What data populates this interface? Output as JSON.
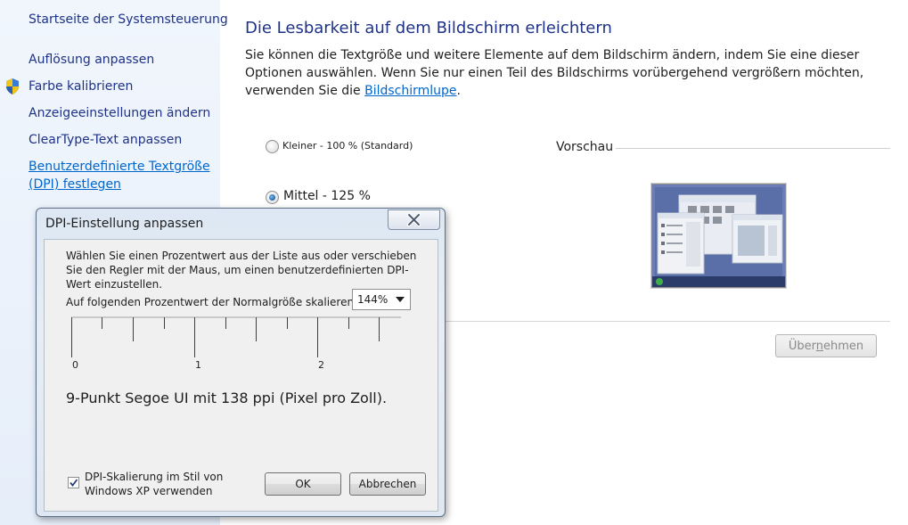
{
  "sidebar": {
    "items": [
      {
        "label": "Startseite der Systemsteuerung"
      },
      {
        "label": "Auflösung anpassen"
      },
      {
        "label": "Farbe kalibrieren"
      },
      {
        "label": "Anzeigeeinstellungen ändern"
      },
      {
        "label": "ClearType-Text anpassen"
      },
      {
        "label": "Benutzerdefinierte Textgröße (DPI) festlegen"
      }
    ]
  },
  "main": {
    "title": "Die Lesbarkeit auf dem Bildschirm erleichtern",
    "description": "Sie können die Textgröße und weitere Elemente auf dem Bildschirm ändern, indem Sie eine dieser Optionen auswählen. Wenn Sie nur einen Teil des Bildschirms vorübergehend vergrößern möchten, verwenden Sie die",
    "magnifier_link": "Bildschirmlupe",
    "period": ".",
    "options": [
      {
        "label": "Kleiner - 100 % (Standard)",
        "checked": false
      },
      {
        "label": "Mittel - 125 %",
        "checked": true
      }
    ],
    "preview_label": "Vorschau",
    "apply_pre": "Über",
    "apply_underline": "n",
    "apply_post": "ehmen"
  },
  "dialog": {
    "title": "DPI-Einstellung anpassen",
    "instructions": "Wählen Sie einen Prozentwert aus der Liste aus oder verschieben Sie den Regler mit der Maus, um einen benutzerdefinierten DPI-Wert einzustellen.",
    "scale_label": "Auf folgenden Prozentwert der Normalgröße skalieren:",
    "scale_value": "144%",
    "ruler_labels": [
      "0",
      "1",
      "2"
    ],
    "font_info": "9-Punkt Segoe UI mit 138 ppi (Pixel pro Zoll).",
    "xp_checkbox_label": "DPI-Skalierung im Stil von Windows XP verwenden",
    "xp_checkbox_checked": true,
    "ok_label": "OK",
    "cancel_label": "Abbrechen"
  },
  "colors": {
    "heading": "#1e3287",
    "link": "#0066cc",
    "sidebar_bg": "#e9f0fa"
  },
  "icons": [
    "uac-shield-icon",
    "close-icon",
    "chevron-down-icon",
    "checkmark-icon"
  ]
}
